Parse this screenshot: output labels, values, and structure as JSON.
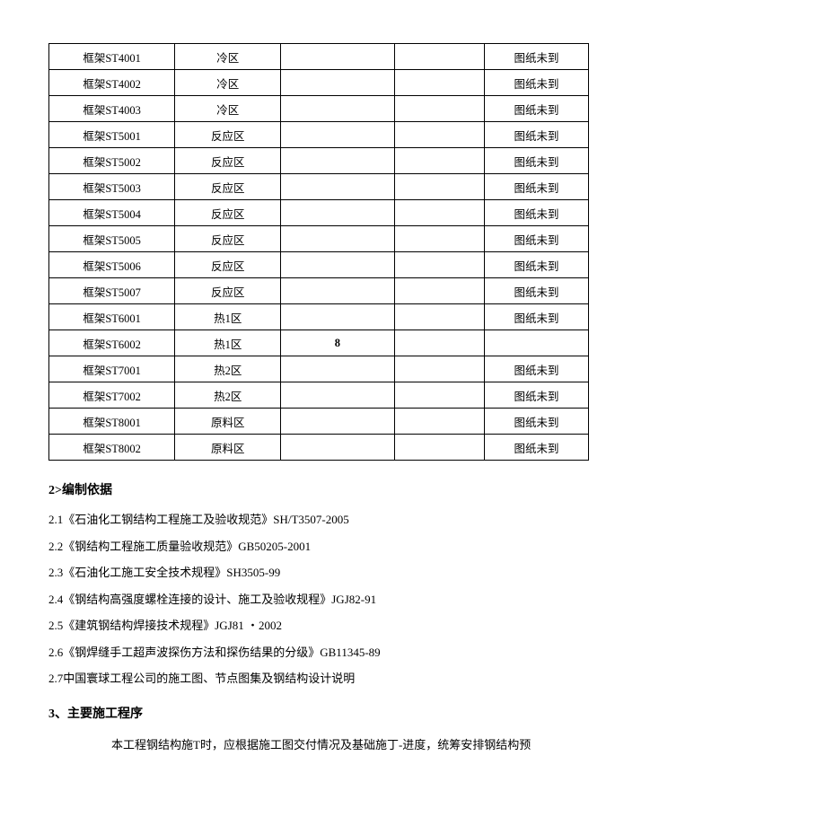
{
  "table": {
    "rows": [
      {
        "c1": "框架ST4001",
        "c2": "冷区",
        "c3": "",
        "c4": "",
        "c5": "图纸未到"
      },
      {
        "c1": "框架ST4002",
        "c2": "冷区",
        "c3": "",
        "c4": "",
        "c5": "图纸未到"
      },
      {
        "c1": "框架ST4003",
        "c2": "冷区",
        "c3": "",
        "c4": "",
        "c5": "图纸未到"
      },
      {
        "c1": "框架ST5001",
        "c2": "反应区",
        "c3": "",
        "c4": "",
        "c5": "图纸未到"
      },
      {
        "c1": "框架ST5002",
        "c2": "反应区",
        "c3": "",
        "c4": "",
        "c5": "图纸未到"
      },
      {
        "c1": "框架ST5003",
        "c2": "反应区",
        "c3": "",
        "c4": "",
        "c5": "图纸未到"
      },
      {
        "c1": "框架ST5004",
        "c2": "反应区",
        "c3": "",
        "c4": "",
        "c5": "图纸未到"
      },
      {
        "c1": "框架ST5005",
        "c2": "反应区",
        "c3": "",
        "c4": "",
        "c5": "图纸未到"
      },
      {
        "c1": "框架ST5006",
        "c2": "反应区",
        "c3": "",
        "c4": "",
        "c5": "图纸未到"
      },
      {
        "c1": "框架ST5007",
        "c2": "反应区",
        "c3": "",
        "c4": "",
        "c5": "图纸未到"
      },
      {
        "c1": "框架ST6001",
        "c2": "热1区",
        "c3": "",
        "c4": "",
        "c5": "图纸未到"
      },
      {
        "c1": "框架ST6002",
        "c2": "热1区",
        "c3": "8",
        "c4": "",
        "c5": ""
      },
      {
        "c1": "框架ST7001",
        "c2": "热2区",
        "c3": "",
        "c4": "",
        "c5": "图纸未到"
      },
      {
        "c1": "框架ST7002",
        "c2": "热2区",
        "c3": "",
        "c4": "",
        "c5": "图纸未到"
      },
      {
        "c1": "框架ST8001",
        "c2": "原料区",
        "c3": "",
        "c4": "",
        "c5": "图纸未到"
      },
      {
        "c1": "框架ST8002",
        "c2": "原料区",
        "c3": "",
        "c4": "",
        "c5": "图纸未到"
      }
    ]
  },
  "section2": {
    "title": "2>编制依据",
    "items": [
      "2.1《石油化工钢结构工程施工及验收规范》SH/T3507-2005",
      "2.2《钢结构工程施工质量验收规范》GB50205-2001",
      "2.3《石油化工施工安全技术规程》SH3505-99",
      "2.4《钢结构高强度螺栓连接的设计、施工及验收规程》JGJ82-91",
      "2.5《建筑钢结构焊接技术规程》JGJ81 ・2002",
      "2.6《钢焊缝手工超声波探伤方法和探伤结果的分级》GB11345-89",
      "2.7中国寰球工程公司的施工图、节点图集及钢结构设计说明"
    ]
  },
  "section3": {
    "title": "3、主要施工程序",
    "body": "本工程钢结构施T时，应根据施工图交付情况及基础施丁-进度，统筹安排钢结构预"
  }
}
